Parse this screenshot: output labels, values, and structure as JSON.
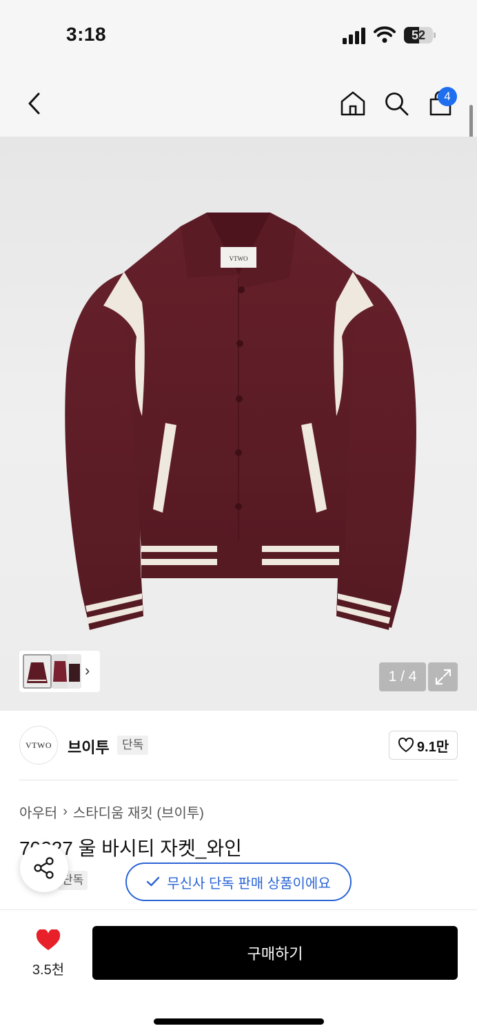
{
  "status_bar": {
    "time": "3:18",
    "battery_percent": 52,
    "battery_label": "52"
  },
  "nav": {
    "back_icon": "chevron-left-icon",
    "home_icon": "home-icon",
    "search_icon": "search-icon",
    "cart_icon": "shopping-bag-icon",
    "cart_badge": "4"
  },
  "gallery": {
    "page_counter": "1 / 4",
    "expand_icon": "expand-icon",
    "thumbnail_arrow": "›"
  },
  "brand": {
    "logo_text": "VTWO",
    "name": "브이투",
    "tag": "단독",
    "like_count": "9.1만"
  },
  "product": {
    "breadcrumb": [
      "아우터",
      "스타디움 재킷 (브이투)"
    ],
    "breadcrumb_separator": "›",
    "title": "70227 울 바시티 자켓_와인",
    "exclusive_tag": "단독",
    "exclusive_notice": "무신사 단독 판매 상품이에요"
  },
  "bottom_bar": {
    "wish_count": "3.5천",
    "buy_label": "구매하기"
  },
  "colors": {
    "accent_blue": "#2a64d6",
    "badge_blue": "#1f6ef0",
    "heart_red": "#e8202a",
    "jacket_wine": "#5e1a24",
    "stripe_cream": "#efe8df"
  }
}
